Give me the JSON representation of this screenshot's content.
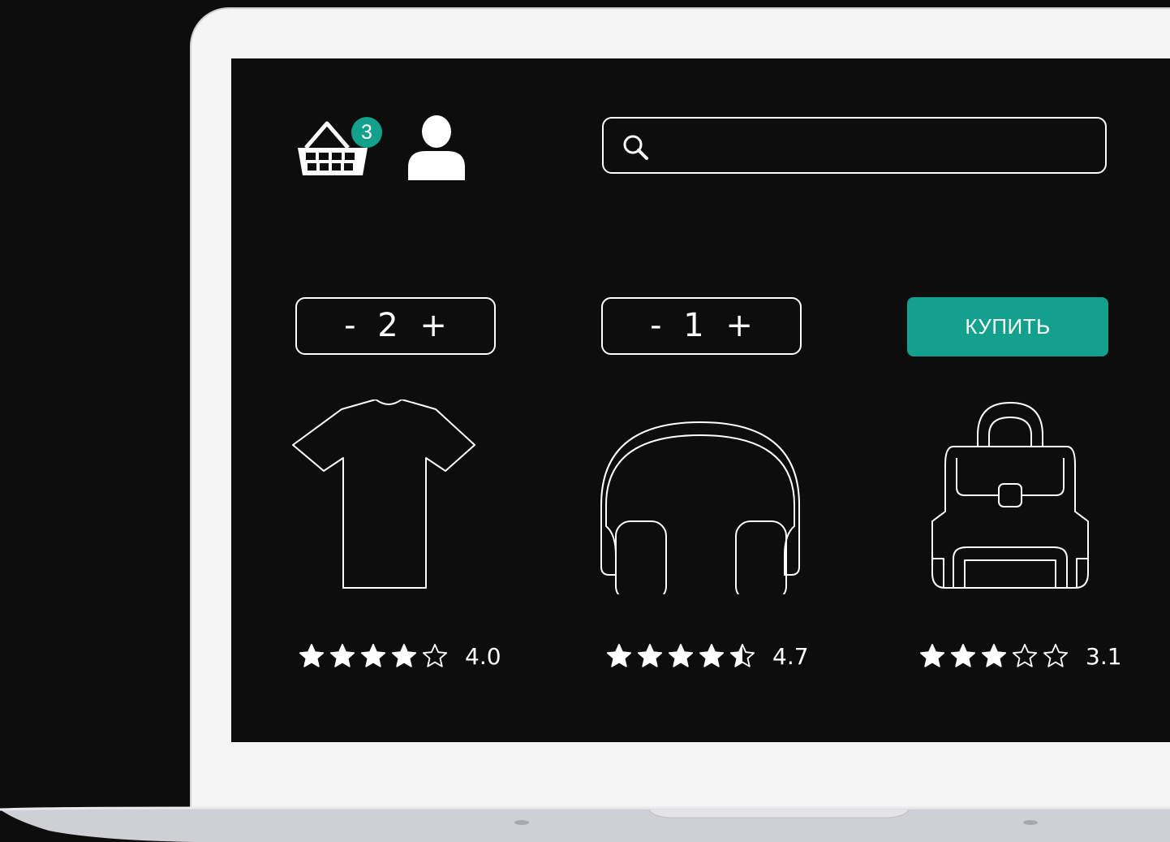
{
  "header": {
    "cart_count": "3",
    "search": {
      "placeholder": "",
      "value": ""
    }
  },
  "products": [
    {
      "name_icon": "t-shirt-icon",
      "quantity": "2",
      "minus": "-",
      "plus": "+",
      "rating": 4.0,
      "rating_label": "4.0"
    },
    {
      "name_icon": "headphones-icon",
      "quantity": "1",
      "minus": "-",
      "plus": "+",
      "rating": 4.7,
      "rating_label": "4.7"
    },
    {
      "name_icon": "backpack-icon",
      "rating": 3.1,
      "rating_label": "3.1"
    }
  ],
  "buy_button": {
    "label": "КУПИТЬ"
  },
  "colors": {
    "accent": "#13a08d",
    "screen_bg": "#0d0d0d",
    "frame": "#f5f5f5"
  }
}
